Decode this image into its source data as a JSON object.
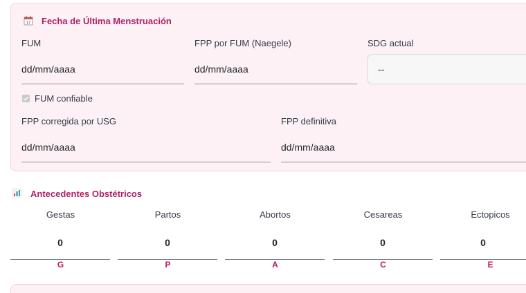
{
  "fum_section": {
    "title": "Fecha de Última Menstruación",
    "icon": "calendar-icon",
    "fum": {
      "label": "FUM",
      "placeholder": "dd/mm/aaaa"
    },
    "fpp_fum": {
      "label": "FPP por FUM (Naegele)",
      "placeholder": "dd/mm/aaaa"
    },
    "sdg": {
      "label": "SDG actual",
      "value": "--"
    },
    "fum_confiable": {
      "label": "FUM confiable",
      "checked": true
    },
    "fpp_usg": {
      "label": "FPP corregida por USG",
      "placeholder": "dd/mm/aaaa"
    },
    "fpp_definitiva": {
      "label": "FPP definitiva",
      "placeholder": "dd/mm/aaaa"
    }
  },
  "obstetric_section": {
    "title": "Antecedentes Obstétricos",
    "icon": "bar-chart-icon",
    "items": [
      {
        "label": "Gestas",
        "value": "0",
        "code": "G"
      },
      {
        "label": "Partos",
        "value": "0",
        "code": "P"
      },
      {
        "label": "Abortos",
        "value": "0",
        "code": "A"
      },
      {
        "label": "Cesareas",
        "value": "0",
        "code": "C"
      },
      {
        "label": "Ectopicos",
        "value": "0",
        "code": "E"
      }
    ]
  },
  "colors": {
    "accent": "#b01f63",
    "card_background": "#fdf1f6",
    "card_border": "#f5cfe0"
  }
}
